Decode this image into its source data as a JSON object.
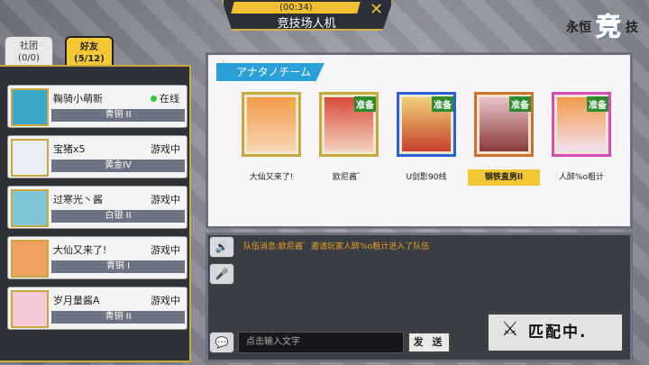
{
  "header": {
    "timer": "(00:34)",
    "title": "竞技场人机",
    "close_icon": "crossed-swords-icon"
  },
  "logo": {
    "left": "永恒",
    "big": "竞",
    "right": "技"
  },
  "tabs": [
    {
      "label": "社团",
      "count": "(0/0)"
    },
    {
      "label": "好友",
      "count": "(5/12)"
    }
  ],
  "friends": [
    {
      "name": "鞠骑小萌新",
      "status": "在线",
      "rank": "青铜 II",
      "online": true
    },
    {
      "name": "宝猪x5",
      "status": "游戏中",
      "rank": "黄金IV",
      "online": false
    },
    {
      "name": "过寒光丶酱",
      "status": "游戏中",
      "rank": "白银 II",
      "online": false
    },
    {
      "name": "大仙又来了!",
      "status": "游戏中",
      "rank": "青铜 I",
      "online": false
    },
    {
      "name": "岁月量酱A",
      "status": "游戏中",
      "rank": "青铜 II",
      "online": false
    }
  ],
  "team": {
    "title": "アナタノチーム",
    "members": [
      {
        "name": "大仙又来了!",
        "ready": "",
        "host": true,
        "selected": false
      },
      {
        "name": "欧尼酱゛",
        "ready": "准备",
        "host": false,
        "selected": false
      },
      {
        "name": "U剑影90线",
        "ready": "准备",
        "host": false,
        "selected": false
      },
      {
        "name": "钢铁直男ll",
        "ready": "准备",
        "host": false,
        "selected": true
      },
      {
        "name": "人醉%o粗计",
        "ready": "准备",
        "host": false,
        "selected": false
      }
    ]
  },
  "chat": {
    "message": "队伍消息:欧尼酱゛邀请玩家人醉%o粗计进入了队伍",
    "placeholder": "点击输入文字",
    "send": "发 送"
  },
  "match_button": "匹配中."
}
